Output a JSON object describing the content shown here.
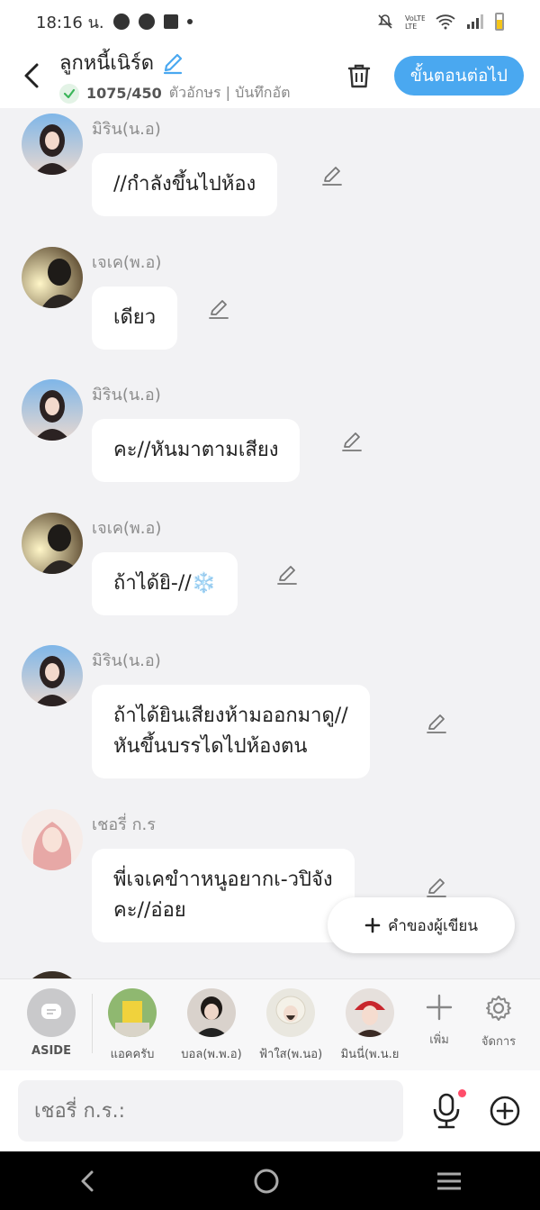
{
  "status": {
    "time": "18:16 น."
  },
  "header": {
    "title": "ลูกหนี้เนิร์ด",
    "char_count": "1075/450",
    "char_unit": "ตัวอักษร | บันทึกอัต",
    "next_label": "ขั้นตอนต่อไป"
  },
  "messages": [
    {
      "name": "มิริน(น.อ)",
      "text": "//กำลังขึ้นไปห้อง"
    },
    {
      "name": "เจเค(พ.อ)",
      "text": "เดียว"
    },
    {
      "name": "มิริน(น.อ)",
      "text": "คะ//หันมาตามเสียง"
    },
    {
      "name": "เจเค(พ.อ)",
      "text": "ถ้าได้ยิ-//❄️"
    },
    {
      "name": "มิริน(น.อ)",
      "text": "ถ้าได้ยินเสียงห้ามออกมาดู//\nหันขึ้นบรรไดไปห้องตน"
    },
    {
      "name": "เชอรี่ ก.ร",
      "text": "พี่เจเคขำาหนูอยากเ-วปิจัง\nคะ//อ่อย"
    }
  ],
  "author_button": "คำของผู้เขียน",
  "characters": {
    "aside": "ASIDE",
    "items": [
      "แอคครับ",
      "บอล(พ.พ.อ)",
      "ฟ้าใส(พ.นอ)",
      "มินนี่(พ.น.ย"
    ],
    "add_label": "เพิ่ม",
    "manage_label": "จัดการ"
  },
  "composer": {
    "placeholder": "เชอรี่ ก.ร.:"
  },
  "colors": {
    "accent": "#4aa8f0",
    "bubble": "#ffffff",
    "background": "#f2f2f4",
    "mic_dot": "#ff4d6a"
  }
}
